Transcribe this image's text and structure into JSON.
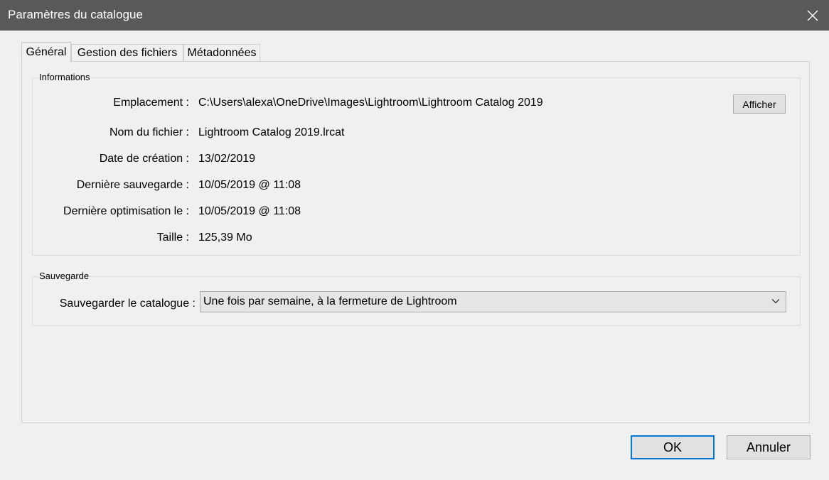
{
  "window": {
    "title": "Paramètres du catalogue"
  },
  "tabs": [
    {
      "label": "Général",
      "active": true
    },
    {
      "label": "Gestion des fichiers",
      "active": false
    },
    {
      "label": "Métadonnées",
      "active": false
    }
  ],
  "informations": {
    "legend": "Informations",
    "rows": [
      {
        "label": "Emplacement :",
        "value": "C:\\Users\\alexa\\OneDrive\\Images\\Lightroom\\Lightroom Catalog 2019"
      },
      {
        "label": "Nom du fichier :",
        "value": "Lightroom Catalog 2019.lrcat"
      },
      {
        "label": "Date de création :",
        "value": "13/02/2019"
      },
      {
        "label": "Dernière sauvegarde :",
        "value": "10/05/2019 @ 11:08"
      },
      {
        "label": "Dernière optimisation le :",
        "value": "10/05/2019 @ 11:08"
      },
      {
        "label": "Taille :",
        "value": "125,39 Mo"
      }
    ],
    "show_button": "Afficher"
  },
  "sauvegarde": {
    "legend": "Sauvegarde",
    "label": "Sauvegarder le catalogue :",
    "selected": "Une fois par semaine, à la fermeture de Lightroom"
  },
  "footer": {
    "ok": "OK",
    "cancel": "Annuler"
  },
  "colors": {
    "titlebar": "#595959",
    "background": "#f0f0f0",
    "focus_border": "#0078d7"
  },
  "icons": {
    "close": "close-icon",
    "dropdown": "chevron-down-icon"
  }
}
